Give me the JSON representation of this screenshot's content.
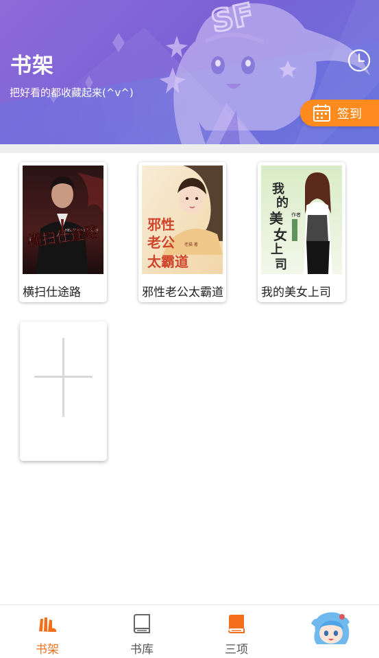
{
  "header": {
    "title": "书架",
    "subtitle": "把好看的都收藏起来(^v^)",
    "logo_text": "SF",
    "history_icon": "clock-icon",
    "signin": {
      "label": "签到",
      "icon": "calendar-icon"
    },
    "colors": {
      "accent": "#ff8a1e",
      "header_bg": "#7d66d8"
    }
  },
  "shelf": {
    "books": [
      {
        "title": "横扫仕途路",
        "cover_text": "横扫仕途路",
        "cover_small_text": "HENGSAO SHITULU"
      },
      {
        "title": "邪性老公太霸道",
        "cover_text": "邪性老公太霸道",
        "cover_small_text": "老猫 著"
      },
      {
        "title": "我的美女上司",
        "cover_text": "我的美女上司",
        "cover_small_text": "作者"
      }
    ],
    "add_icon": "plus-icon"
  },
  "bottom_nav": {
    "items": [
      {
        "label": "书架",
        "icon": "bookshelf-icon",
        "active": true
      },
      {
        "label": "书库",
        "icon": "book-library-icon",
        "active": false
      },
      {
        "label": "三项",
        "icon": "book-icon",
        "active": false
      }
    ],
    "avatar_icon": "anime-avatar-icon",
    "active_color": "#f36f1e"
  }
}
